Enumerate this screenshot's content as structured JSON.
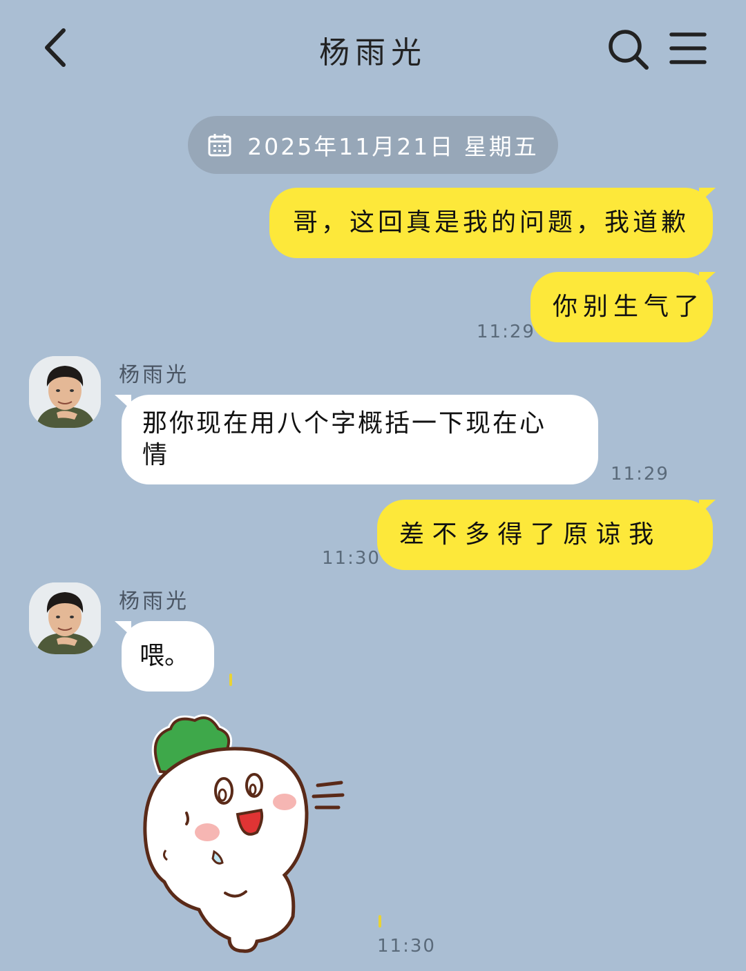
{
  "header": {
    "title": "杨雨光",
    "back_icon": "chevron-left-icon",
    "search_icon": "search-icon",
    "menu_icon": "menu-icon"
  },
  "date_separator": {
    "icon": "calendar-icon",
    "text": "2025年11月21日 星期五"
  },
  "messages": [
    {
      "direction": "outgoing",
      "text": "哥，这回真是我的问题，我道歉"
    },
    {
      "direction": "outgoing",
      "text": "你别生气了",
      "time": "11:29"
    },
    {
      "direction": "incoming",
      "sender": "杨雨光",
      "text_line1": "那你现在用八个字概括一下现在心",
      "text_line2": "情",
      "time": "11:29"
    },
    {
      "direction": "outgoing",
      "text": "差 不 多 得 了 原 谅 我",
      "time": "11:30"
    },
    {
      "direction": "incoming",
      "sender": "杨雨光",
      "text": "喂。"
    },
    {
      "direction": "incoming",
      "type": "sticker",
      "sticker": "radish-character-sticker",
      "time": "11:30"
    }
  ],
  "colors": {
    "background": "#aabed3",
    "outgoing_bubble": "#fde83a",
    "incoming_bubble": "#ffffff",
    "date_pill": "#97a7b8"
  }
}
